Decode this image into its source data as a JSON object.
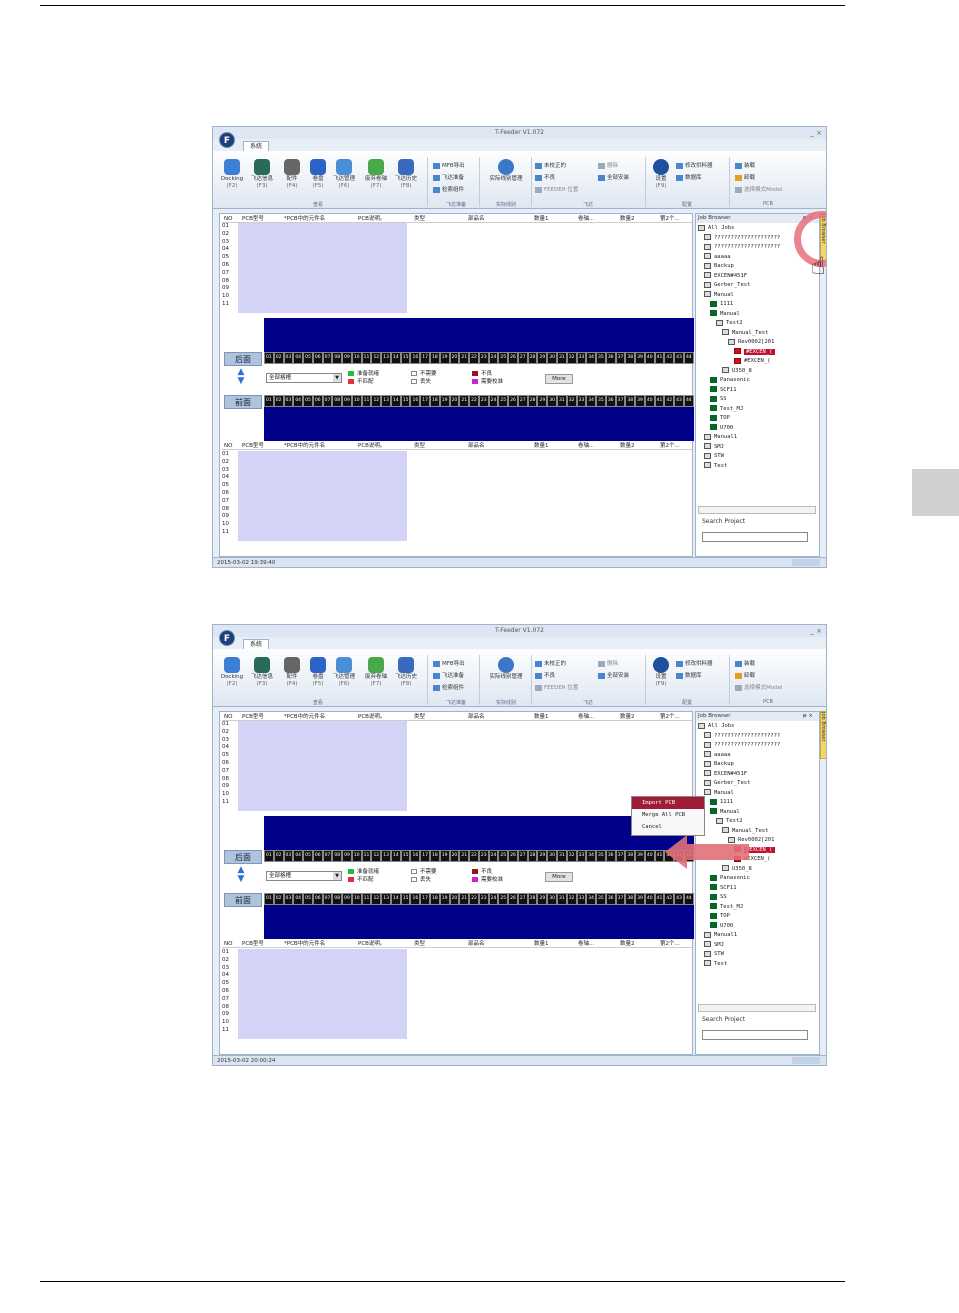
{
  "window": {
    "title": "T-Feeder V1.072",
    "controls": "_ ×",
    "logo": "F",
    "tab": "系統"
  },
  "ribbon": {
    "buttons": [
      {
        "label": "Docking",
        "key": "(F2)",
        "color": "#3c7fd4"
      },
      {
        "label": "飞达信息",
        "key": "(F3)",
        "color": "#2a6a5a"
      },
      {
        "label": "配件",
        "key": "(F4)",
        "color": "#666666"
      },
      {
        "label": "卷盘",
        "key": "(F5)",
        "color": "#2d62c9"
      },
      {
        "label": "飞达管理",
        "key": "(F6)",
        "color": "#4b8ed8"
      },
      {
        "label": "废弃卷轴",
        "key": "(F7)",
        "color": "#48a84c"
      },
      {
        "label": "飞达历史",
        "key": "(F8)",
        "color": "#3a6ac0"
      }
    ],
    "group1": "查看",
    "mfb": [
      "MFB导出",
      "飞达准备",
      "检索组件"
    ],
    "group2": "飞达准备",
    "prod": "实际线别管理",
    "group3": "实际线别",
    "feeder": [
      "未校正的",
      "不良",
      "FEEDER 位置"
    ],
    "delete": [
      "删除",
      "全部安装"
    ],
    "group4": "飞达",
    "settings": "设置",
    "settings_key": "(F9)",
    "config": [
      "修改供料器",
      "数据库"
    ],
    "group5": "配置",
    "pcb": [
      "装载",
      "卸载",
      "选择模式Model"
    ],
    "group6": "PCB"
  },
  "grid": {
    "headers": [
      "NO",
      "PCB型号",
      "*PCB中的元件名",
      "PCB说明。",
      "类型",
      "部品名",
      "数量1",
      "卷轴...",
      "数量2",
      "第2个..."
    ],
    "rows": [
      "01",
      "02",
      "03",
      "04",
      "05",
      "06",
      "07",
      "08",
      "09",
      "10",
      "11"
    ]
  },
  "slots": [
    "01",
    "02",
    "03",
    "04",
    "05",
    "06",
    "07",
    "08",
    "09",
    "10",
    "11",
    "12",
    "13",
    "14",
    "15",
    "16",
    "17",
    "18",
    "19",
    "20",
    "21",
    "22",
    "23",
    "24",
    "25",
    "26",
    "27",
    "28",
    "29",
    "30",
    "31",
    "32",
    "33",
    "34",
    "35",
    "36",
    "37",
    "38",
    "39",
    "40",
    "41",
    "42",
    "43",
    "44"
  ],
  "rear_label": "后面",
  "front_label": "前面",
  "filter": "全部格槽",
  "legend": [
    {
      "label": "准备就绪",
      "color": "#1fbf3a"
    },
    {
      "label": "不匹配",
      "color": "#e0303a"
    },
    {
      "label": "不需要",
      "color": "#ffffff"
    },
    {
      "label": "丢失",
      "color": "#ffffff"
    },
    {
      "label": "不良",
      "color": "#a0101a"
    },
    {
      "label": "需要校准",
      "color": "#d020d0"
    }
  ],
  "more": "More",
  "browser": {
    "title": "Job Browser",
    "pin": "ᵽ ×",
    "tab": "Job Browser",
    "tree": [
      "All Jobs",
      "????????????????????",
      "????????????????????",
      "aaaaa",
      "Backup",
      "EXCEN#451F",
      "Gerber_Test",
      "Manual",
      "1111",
      "Manual",
      "Test2",
      "Manual_Test",
      "Rev0002[201",
      "#EXCEN_(",
      "#EXCEN_(",
      "U350_8",
      "Panasonic",
      "SCF11",
      "SS",
      "Test_MJ",
      "TOP",
      "U700",
      "Manual1",
      "SMJ",
      "STW",
      "Test"
    ],
    "search_label": "Search Project"
  },
  "status1": "2015-03-02 19:39:40",
  "status2": "2015-03-02 20:00:24",
  "context_menu": [
    "Import PCB",
    "Merge All PCB",
    "Cancel"
  ]
}
